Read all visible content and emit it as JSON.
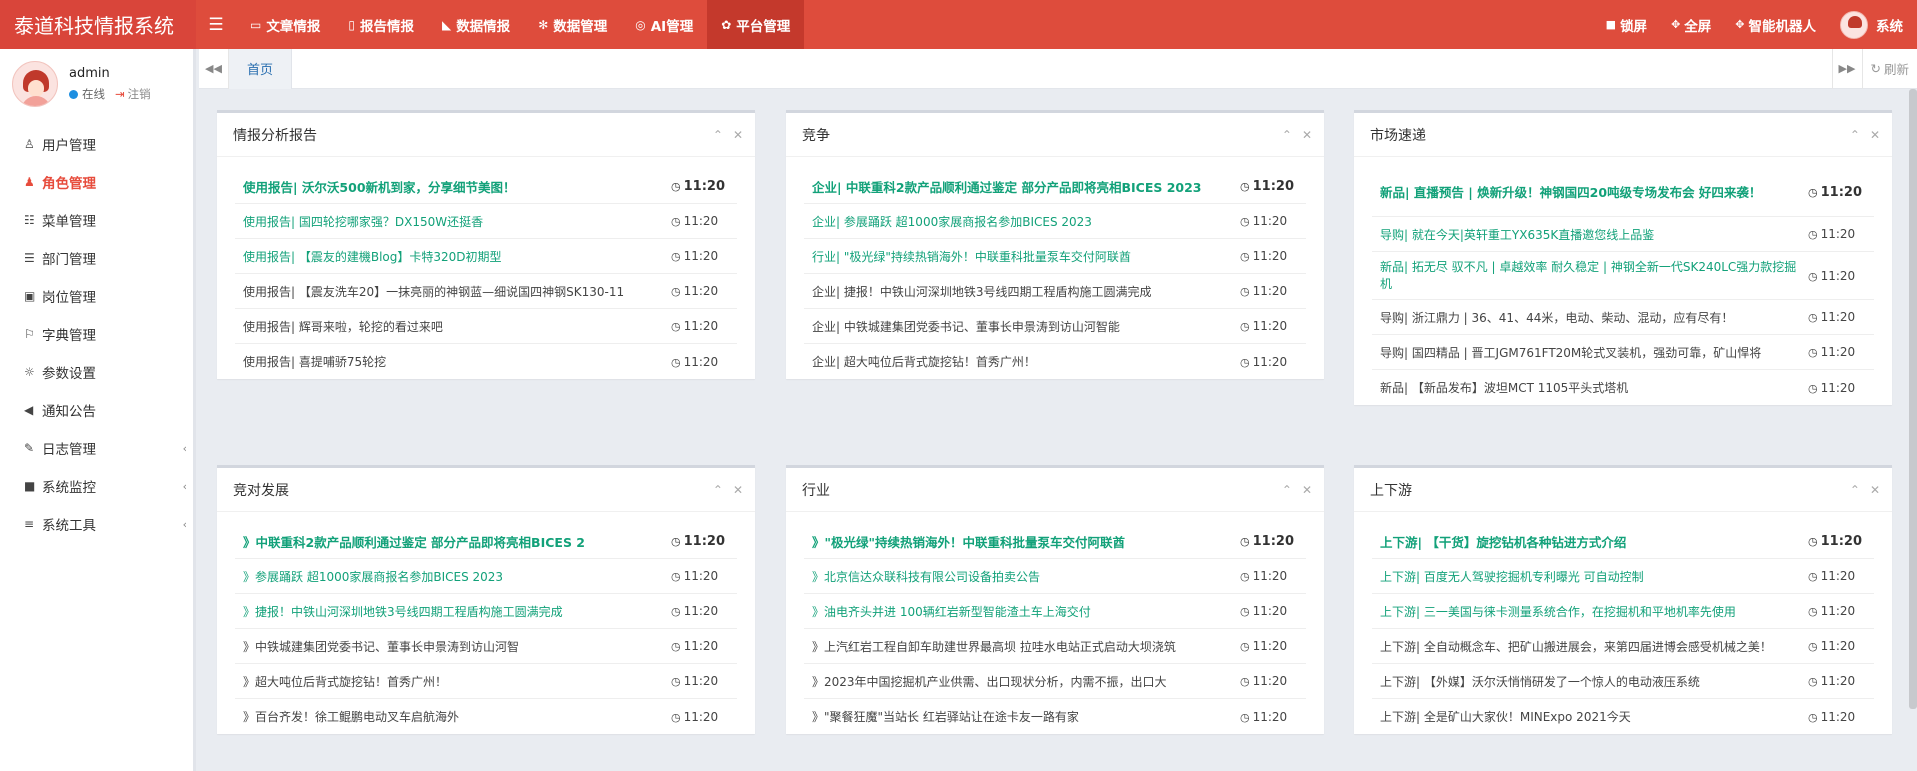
{
  "header": {
    "title": "泰道科技情报系统",
    "nav": [
      {
        "icon": "monitor-icon",
        "glyph": "▭",
        "label": "文章情报"
      },
      {
        "icon": "file-pdf-icon",
        "glyph": "▯",
        "label": "报告情报"
      },
      {
        "icon": "area-chart-icon",
        "glyph": "◣",
        "label": "数据情报"
      },
      {
        "icon": "bug-icon",
        "glyph": "✻",
        "label": "数据管理"
      },
      {
        "icon": "globe-icon",
        "glyph": "◎",
        "label": "AI管理"
      },
      {
        "icon": "gear-icon",
        "glyph": "✿",
        "label": "平台管理"
      }
    ],
    "right": {
      "lock": "锁屏",
      "fullscreen": "全屏",
      "robot": "智能机器人",
      "user": "系统"
    }
  },
  "sidebar": {
    "username": "admin",
    "status": "在线",
    "logout": "注销",
    "menu": [
      {
        "icon": "user-icon",
        "glyph": "♙",
        "label": "用户管理"
      },
      {
        "icon": "user-secret-icon",
        "glyph": "♟",
        "label": "角色管理"
      },
      {
        "icon": "th-list-icon",
        "glyph": "☷",
        "label": "菜单管理"
      },
      {
        "icon": "outdent-icon",
        "glyph": "☰",
        "label": "部门管理"
      },
      {
        "icon": "address-card-icon",
        "glyph": "▣",
        "label": "岗位管理"
      },
      {
        "icon": "bookmark-icon",
        "glyph": "⚐",
        "label": "字典管理"
      },
      {
        "icon": "sun-icon",
        "glyph": "☼",
        "label": "参数设置"
      },
      {
        "icon": "bullhorn-icon",
        "glyph": "◀",
        "label": "通知公告"
      },
      {
        "icon": "edit-icon",
        "glyph": "✎",
        "label": "日志管理"
      },
      {
        "icon": "video-icon",
        "glyph": "■",
        "label": "系统监控"
      },
      {
        "icon": "bars-icon",
        "glyph": "≡",
        "label": "系统工具"
      }
    ]
  },
  "tabbar": {
    "home": "首页",
    "refresh": "刷新"
  },
  "panels": [
    {
      "title": "情报分析报告",
      "rows": [
        {
          "text": "使用报告| 沃尔沃500新机到家，分享细节美图！",
          "time": "11:20"
        },
        {
          "text": "使用报告| 国四轮挖哪家强？DX150W还挺香",
          "time": "11:20"
        },
        {
          "text": "使用报告| 【震友的建機Blog】卡特320D初期型",
          "time": "11:20"
        },
        {
          "text": "使用报告| 【震友洗车20】一抹亮丽的神钢蓝—细说国四神钢SK130-11",
          "time": "11:20"
        },
        {
          "text": "使用报告| 辉哥来啦，轮挖的看过来吧",
          "time": "11:20"
        },
        {
          "text": "使用报告| 喜提哺骄75轮挖",
          "time": "11:20"
        }
      ]
    },
    {
      "title": "竞争",
      "rows": [
        {
          "text": "企业| 中联重科2款产品顺利通过鉴定 部分产品即将亮相BICES 2023",
          "time": "11:20"
        },
        {
          "text": "企业| 参展踊跃 超1000家展商报名参加BICES 2023",
          "time": "11:20"
        },
        {
          "text": "行业| \"极光绿\"持续热销海外！中联重科批量泵车交付阿联酋",
          "time": "11:20"
        },
        {
          "text": "企业| 捷报！中铁山河深圳地铁3号线四期工程盾构施工圆满完成",
          "time": "11:20"
        },
        {
          "text": "企业| 中铁城建集团党委书记、董事长申景涛到访山河智能",
          "time": "11:20"
        },
        {
          "text": "企业| 超大吨位后背式旋挖钻！首秀广州！",
          "time": "11:20"
        }
      ]
    },
    {
      "title": "市场速递",
      "rows": [
        {
          "text": "新品| 直播预告 | 焕新升级！神钢国四20吨级专场发布会 好四来袭！",
          "time": "11:20"
        },
        {
          "text": "导购| 就在今天|英轩重工YX635K直播邀您线上品鉴",
          "time": "11:20"
        },
        {
          "text": "新品| 拓无尽 驭不凡 | 卓越效率 耐久稳定 | 神钢全新一代SK240LC强力款挖掘机",
          "time": "11:20"
        },
        {
          "text": "导购| 浙江鼎力 | 36、41、44米，电动、柴动、混动，应有尽有！",
          "time": "11:20"
        },
        {
          "text": "导购| 国四精品 | 晋工JGM761FT20M轮式叉装机，强劲可靠，矿山悍将",
          "time": "11:20"
        },
        {
          "text": "新品| 【新品发布】波坦MCT 1105平头式塔机",
          "time": "11:20"
        }
      ]
    },
    {
      "title": "竞对发展",
      "rows": [
        {
          "text": "》中联重科2款产品顺利通过鉴定 部分产品即将亮相BICES 2",
          "time": "11:20"
        },
        {
          "text": "》参展踊跃 超1000家展商报名参加BICES 2023",
          "time": "11:20"
        },
        {
          "text": "》捷报！中铁山河深圳地铁3号线四期工程盾构施工圆满完成",
          "time": "11:20"
        },
        {
          "text": "》中铁城建集团党委书记、董事长申景涛到访山河智",
          "time": "11:20"
        },
        {
          "text": "》超大吨位后背式旋挖钻！首秀广州！",
          "time": "11:20"
        },
        {
          "text": "》百台齐发！徐工鲲鹏电动叉车启航海外",
          "time": "11:20"
        }
      ]
    },
    {
      "title": "行业",
      "rows": [
        {
          "text": "》\"极光绿\"持续热销海外！中联重科批量泵车交付阿联酋",
          "time": "11:20"
        },
        {
          "text": "》北京信达众联科技有限公司设备拍卖公告",
          "time": "11:20"
        },
        {
          "text": "》油电齐头并进 100辆红岩新型智能渣土车上海交付",
          "time": "11:20"
        },
        {
          "text": "》上汽红岩工程自卸车助建世界最高坝 拉哇水电站正式启动大坝浇筑",
          "time": "11:20"
        },
        {
          "text": "》2023年中国挖掘机产业供需、出口现状分析，内需不振，出口大",
          "time": "11:20"
        },
        {
          "text": "》\"聚餐狂魔\"当站长 红岩驿站让在途卡友一路有家",
          "time": "11:20"
        }
      ]
    },
    {
      "title": "上下游",
      "rows": [
        {
          "text": "上下游| 【干货】旋挖钻机各种钻进方式介绍",
          "time": "11:20"
        },
        {
          "text": "上下游| 百度无人驾驶挖掘机专利曝光 可自动控制",
          "time": "11:20"
        },
        {
          "text": "上下游| 三一美国与徕卡测量系统合作，在挖掘机和平地机率先使用",
          "time": "11:20"
        },
        {
          "text": "上下游| 全自动概念车、把矿山搬进展会，来第四届进博会感受机械之美！",
          "time": "11:20"
        },
        {
          "text": "上下游| 【外媒】沃尔沃悄悄研发了一个惊人的电动液压系统",
          "time": "11:20"
        },
        {
          "text": "上下游| 全是矿山大家伙！MINExpo 2021今天",
          "time": "11:20"
        }
      ]
    }
  ],
  "colors": {
    "header": "#de4c3c",
    "accent_green": "#12a179",
    "active_menu": "#e74c3c"
  }
}
